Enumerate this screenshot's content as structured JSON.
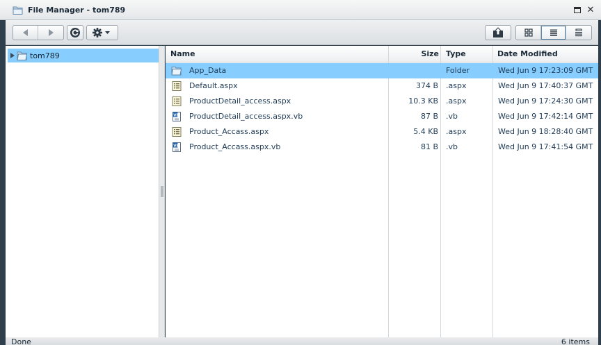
{
  "window": {
    "title": "File Manager - tom789"
  },
  "toolbar": {
    "back": "back-icon",
    "forward": "forward-icon",
    "refresh": "refresh-icon",
    "settings": "gear-icon",
    "up": "up-folder-icon",
    "views": [
      "thumbnails-view-icon",
      "details-view-icon",
      "tiles-view-icon"
    ],
    "active_view": "details"
  },
  "tree": {
    "root_label": "tom789"
  },
  "list": {
    "columns": {
      "name": "Name",
      "size": "Size",
      "type": "Type",
      "date": "Date Modified"
    },
    "rows": [
      {
        "name": "App_Data",
        "size": "",
        "type": "Folder",
        "date": "Wed Jun 9 17:23:09 GMT",
        "icon": "folder-icon",
        "selected": true
      },
      {
        "name": "Default.aspx",
        "size": "374  B",
        "type": ".aspx",
        "date": "Wed Jun 9 17:40:37 GMT",
        "icon": "aspx-file-icon"
      },
      {
        "name": "ProductDetail_access.aspx",
        "size": "10.3 KB",
        "type": ".aspx",
        "date": "Wed Jun 9 17:24:30 GMT",
        "icon": "aspx-file-icon"
      },
      {
        "name": "ProductDetail_access.aspx.vb",
        "size": "87  B",
        "type": ".vb",
        "date": "Wed Jun 9 17:42:14 GMT",
        "icon": "vb-file-icon"
      },
      {
        "name": "Product_Accass.aspx",
        "size": "5.4 KB",
        "type": ".aspx",
        "date": "Wed Jun 9 18:28:40 GMT",
        "icon": "aspx-file-icon"
      },
      {
        "name": "Product_Accass.aspx.vb",
        "size": "81  B",
        "type": ".vb",
        "date": "Wed Jun 9 17:41:54 GMT",
        "icon": "vb-file-icon"
      }
    ]
  },
  "status": {
    "left": "Done",
    "right": "6 items"
  },
  "colors": {
    "selection": "#87ceff",
    "frame": "#2f3f4c"
  }
}
